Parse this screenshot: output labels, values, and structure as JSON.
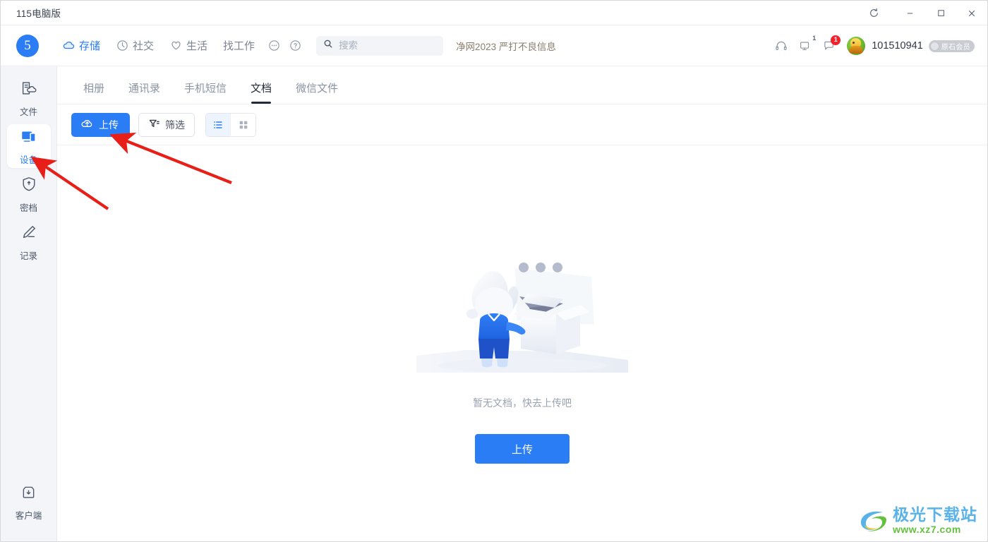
{
  "window": {
    "title": "115电脑版",
    "controls": [
      {
        "name": "refresh",
        "label": "⟳"
      },
      {
        "name": "minimize",
        "label": "—"
      },
      {
        "name": "maximize",
        "label": "□"
      },
      {
        "name": "close",
        "label": "✕"
      }
    ]
  },
  "topnav": {
    "logo_text": "5",
    "items": [
      {
        "label": "存储",
        "icon": "cloud-icon",
        "active": true
      },
      {
        "label": "社交",
        "icon": "clock-icon",
        "active": false
      },
      {
        "label": "生活",
        "icon": "heart-icon",
        "active": false
      },
      {
        "label": "找工作",
        "icon": "",
        "active": false
      }
    ],
    "more_icon": "more-dots-icon",
    "help_icon": "question-circle-icon",
    "notice": "净网2023 严打不良信息"
  },
  "search": {
    "placeholder": "搜索",
    "value": "",
    "icon": "search-icon"
  },
  "user": {
    "headset_icon": "headset-icon",
    "monitor_icon": "monitor-icon",
    "monitor_badge": "1",
    "message_icon": "message-icon",
    "message_badge": "1",
    "avatar": "user-avatar",
    "name": "101510941",
    "vip_label": "原石会员"
  },
  "sidebar": {
    "items": [
      {
        "label": "文件",
        "icon": "file-cloud-icon",
        "active": false
      },
      {
        "label": "设备",
        "icon": "device-icon",
        "active": true
      },
      {
        "label": "密档",
        "icon": "shield-lock-icon",
        "active": false
      },
      {
        "label": "记录",
        "icon": "pencil-icon",
        "active": false
      }
    ],
    "bottom": {
      "label": "客户端",
      "icon": "download-box-icon"
    }
  },
  "tabs": [
    {
      "label": "相册",
      "active": false
    },
    {
      "label": "通讯录",
      "active": false
    },
    {
      "label": "手机短信",
      "active": false
    },
    {
      "label": "文档",
      "active": true
    },
    {
      "label": "微信文件",
      "active": false
    }
  ],
  "toolbar": {
    "upload_label": "上传",
    "upload_icon": "cloud-upload-icon",
    "filter_label": "筛选",
    "filter_icon": "filter-icon",
    "list_view_icon": "list-view-icon",
    "grid_view_icon": "grid-view-icon",
    "active_view": "list"
  },
  "empty_state": {
    "illustration": "empty-box-character-illustration",
    "message": "暂无文档，快去上传吧",
    "button_label": "上传"
  },
  "annotations": [
    {
      "name": "arrow-to-upload-button",
      "color": "#e81f18"
    },
    {
      "name": "arrow-to-sidebar-device",
      "color": "#e81f18"
    }
  ],
  "watermark": {
    "title": "极光下载站",
    "url": "www.xz7.com"
  },
  "colors": {
    "accent": "#2a7df4",
    "sidebar_bg": "#f3f5f8",
    "text_primary": "#303846",
    "text_muted": "#8a93a2",
    "annotation_red": "#e81f18",
    "badge_red": "#f5222d"
  }
}
